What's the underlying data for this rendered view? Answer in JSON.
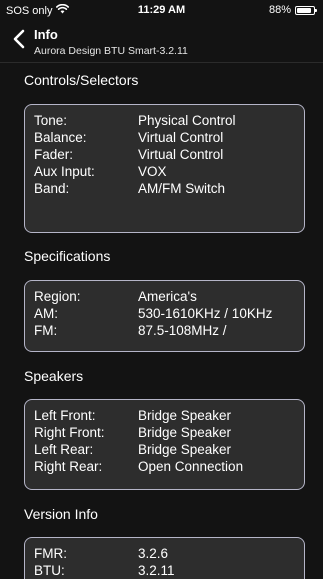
{
  "status_bar": {
    "carrier": "SOS only",
    "time": "11:29 AM",
    "battery_percent": "88%",
    "battery_level": 0.88,
    "wifi_icon": "wifi-icon"
  },
  "nav": {
    "title": "Info",
    "subtitle": "Aurora Design BTU Smart-3.2.11",
    "back_icon": "chevron-left-icon"
  },
  "sections": {
    "controls": {
      "title": "Controls/Selectors",
      "rows": [
        {
          "label": "Tone:",
          "value": "Physical Control"
        },
        {
          "label": "Balance:",
          "value": "Virtual Control"
        },
        {
          "label": "Fader:",
          "value": "Virtual Control"
        },
        {
          "label": "Aux Input:",
          "value": "VOX"
        },
        {
          "label": "Band:",
          "value": "AM/FM Switch"
        }
      ]
    },
    "specifications": {
      "title": "Specifications",
      "rows": [
        {
          "label": "Region:",
          "value": "America's"
        },
        {
          "label": "AM:",
          "value": "530-1610KHz / 10KHz"
        },
        {
          "label": "FM:",
          "value": "87.5-108MHz /"
        }
      ]
    },
    "speakers": {
      "title": "Speakers",
      "rows": [
        {
          "label": "Left Front:",
          "value": "Bridge Speaker"
        },
        {
          "label": "Right Front:",
          "value": "Bridge Speaker"
        },
        {
          "label": "Left Rear:",
          "value": "Bridge Speaker"
        },
        {
          "label": "Right Rear:",
          "value": "Open Connection"
        }
      ]
    },
    "version": {
      "title": "Version Info",
      "rows": [
        {
          "label": "FMR:",
          "value": "3.2.6"
        },
        {
          "label": "BTU:",
          "value": "3.2.11"
        }
      ]
    }
  },
  "colors": {
    "background": "#131313",
    "card_background": "#2d2d2d",
    "card_border": "#b5b5c8"
  }
}
